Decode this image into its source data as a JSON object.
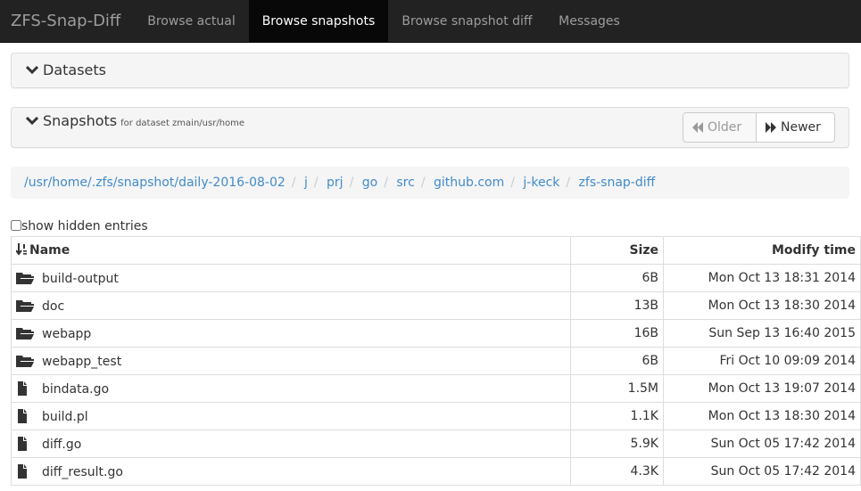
{
  "navbar": {
    "brand": "ZFS-Snap-Diff",
    "tabs": [
      {
        "label": "Browse actual",
        "active": false
      },
      {
        "label": "Browse snapshots",
        "active": true
      },
      {
        "label": "Browse snapshot diff",
        "active": false
      },
      {
        "label": "Messages",
        "active": false
      }
    ]
  },
  "datasets_panel": {
    "title": "Datasets"
  },
  "snapshots_panel": {
    "title": "Snapshots",
    "subtitle": "for dataset zmain/usr/home",
    "older_label": "Older",
    "newer_label": "Newer"
  },
  "breadcrumb": [
    "/usr/home/.zfs/snapshot/daily-2016-08-02",
    "j",
    "prj",
    "go",
    "src",
    "github.com",
    "j-keck",
    "zfs-snap-diff"
  ],
  "show_hidden": {
    "label": "show hidden entries",
    "checked": false
  },
  "table": {
    "headers": {
      "name": "Name",
      "size": "Size",
      "mtime": "Modify time"
    },
    "rows": [
      {
        "type": "folder-icon",
        "name": "build-output",
        "size": "6B",
        "mtime": "Mon Oct 13 18:31 2014"
      },
      {
        "type": "folder-icon",
        "name": "doc",
        "size": "13B",
        "mtime": "Mon Oct 13 18:30 2014"
      },
      {
        "type": "folder-icon",
        "name": "webapp",
        "size": "16B",
        "mtime": "Sun Sep 13 16:40 2015"
      },
      {
        "type": "folder-icon",
        "name": "webapp_test",
        "size": "6B",
        "mtime": "Fri Oct 10 09:09 2014"
      },
      {
        "type": "file-icon",
        "name": "bindata.go",
        "size": "1.5M",
        "mtime": "Mon Oct 13 19:07 2014"
      },
      {
        "type": "file-icon",
        "name": "build.pl",
        "size": "1.1K",
        "mtime": "Mon Oct 13 18:30 2014"
      },
      {
        "type": "file-icon",
        "name": "diff.go",
        "size": "5.9K",
        "mtime": "Sun Oct 05 17:42 2014"
      },
      {
        "type": "file-icon",
        "name": "diff_result.go",
        "size": "4.3K",
        "mtime": "Sun Oct 05 17:42 2014"
      }
    ]
  }
}
